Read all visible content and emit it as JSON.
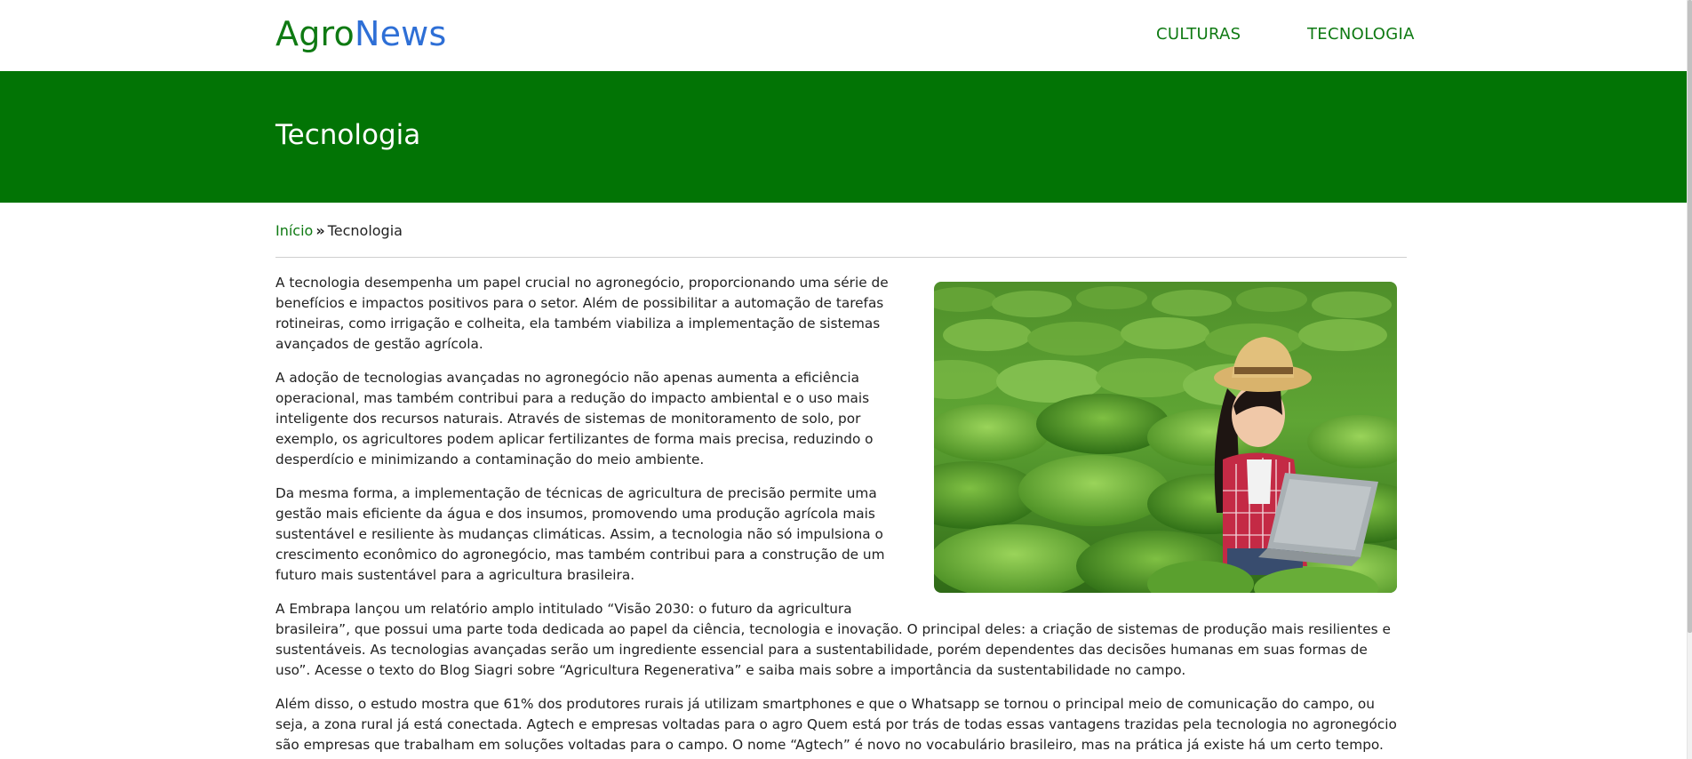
{
  "header": {
    "logo_part1": "Agro",
    "logo_part2": "News",
    "nav": [
      {
        "label": "CULTURAS"
      },
      {
        "label": "TECNOLOGIA"
      }
    ]
  },
  "banner": {
    "title": "Tecnologia"
  },
  "breadcrumb": {
    "home": "Início",
    "separator": "»",
    "current": "Tecnologia"
  },
  "article": {
    "paragraphs": [
      "A tecnologia desempenha um papel crucial no agronegócio, proporcionando uma série de benefícios e impactos positivos para o setor. Além de possibilitar a automação de tarefas rotineiras, como irrigação e colheita, ela também viabiliza a implementação de sistemas avançados de gestão agrícola.",
      "A adoção de tecnologias avançadas no agronegócio não apenas aumenta a eficiência operacional, mas também contribui para a redução do impacto ambiental e o uso mais inteligente dos recursos naturais. Através de sistemas de monitoramento de solo, por exemplo, os agricultores podem aplicar fertilizantes de forma mais precisa, reduzindo o desperdício e minimizando a contaminação do meio ambiente.",
      "Da mesma forma, a implementação de técnicas de agricultura de precisão permite uma gestão mais eficiente da água e dos insumos, promovendo uma produção agrícola mais sustentável e resiliente às mudanças climáticas. Assim, a tecnologia não só impulsiona o crescimento econômico do agronegócio, mas também contribui para a construção de um futuro mais sustentável para a agricultura brasileira.",
      "A Embrapa lançou um relatório amplo intitulado “Visão 2030: o futuro da agricultura brasileira”, que possui uma parte toda dedicada ao papel da ciência, tecnologia e inovação. O principal deles: a criação de sistemas de produção mais resilientes e sustentáveis. As tecnologias avançadas serão um ingrediente essencial para a sustentabilidade, porém dependentes das decisões humanas em suas formas de uso”. Acesse o texto do Blog Siagri sobre “Agricultura Regenerativa” e saiba mais sobre a importância da sustentabilidade no campo.",
      "Além disso, o estudo mostra que 61% dos produtores rurais já utilizam smartphones e que o Whatsapp se tornou o principal meio de comunicação do campo, ou seja, a zona rural já está conectada. Agtech e empresas voltadas para o agro Quem está por trás de todas essas vantagens trazidas pela tecnologia no agronegócio são empresas que trabalham em soluções voltadas para o campo. O nome “Agtech” é novo no vocabulário brasileiro, mas na prática já existe há um certo tempo."
    ],
    "image_icon": "farmer-with-laptop-in-field-photo"
  },
  "colors": {
    "brand_green": "#027405",
    "link_green": "#0f7a13",
    "logo_blue": "#2e6fd6"
  }
}
